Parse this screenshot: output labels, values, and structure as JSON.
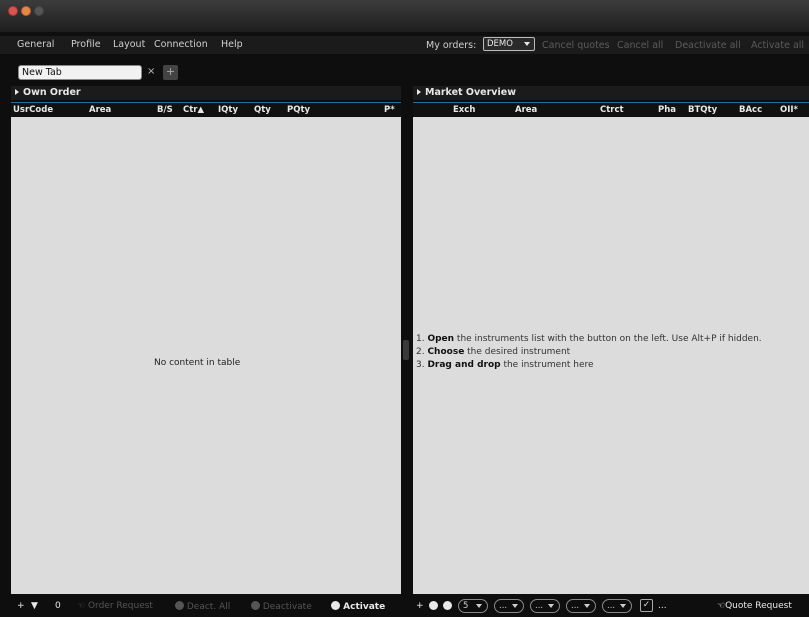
{
  "menu": {
    "items": [
      "General",
      "Profile",
      "Layout",
      "Connection",
      "Help"
    ],
    "my_orders_label": "My orders:",
    "demo_value": "DEMO",
    "actions": [
      "Cancel quotes",
      "Cancel all",
      "Deactivate all",
      "Activate all"
    ]
  },
  "tabs": {
    "current": "New Tab",
    "close": "×",
    "add": "+"
  },
  "own_order": {
    "title": "Own Order",
    "columns": [
      "UsrCode",
      "Area",
      "B/S",
      "Ctr▲",
      "IQty",
      "Qty",
      "PQty",
      "P*"
    ],
    "empty_message": "No content in table",
    "toolbar": {
      "add": "+",
      "filter_count": "0",
      "order_request": "Order Request",
      "deact_all": "Deact. All",
      "deactivate": "Deactivate",
      "activate": "Activate"
    }
  },
  "market_overview": {
    "title": "Market Overview",
    "columns": [
      "Exch",
      "Area",
      "Ctrct",
      "Pha",
      "BTQty",
      "BAcc",
      "OII*"
    ],
    "instructions": {
      "line1_bold": "Open",
      "line1_text": " the instruments list with the  button on the left. Use Alt+P if hidden.",
      "line2_bold": "Choose",
      "line2_text": " the desired instrument",
      "line3_bold": "Drag and drop",
      "line3_text": " the instrument here"
    },
    "toolbar": {
      "add": "+",
      "combo1": "5",
      "combo_placeholder": "...",
      "checkbox_mark": "✓",
      "ellipsis": "...",
      "quote_request": "Quote Request"
    }
  },
  "colors": {
    "header_accent": "#1f6fa8",
    "table_bg": "#dcdcdc",
    "chrome_bg": "#0e0e0e"
  }
}
